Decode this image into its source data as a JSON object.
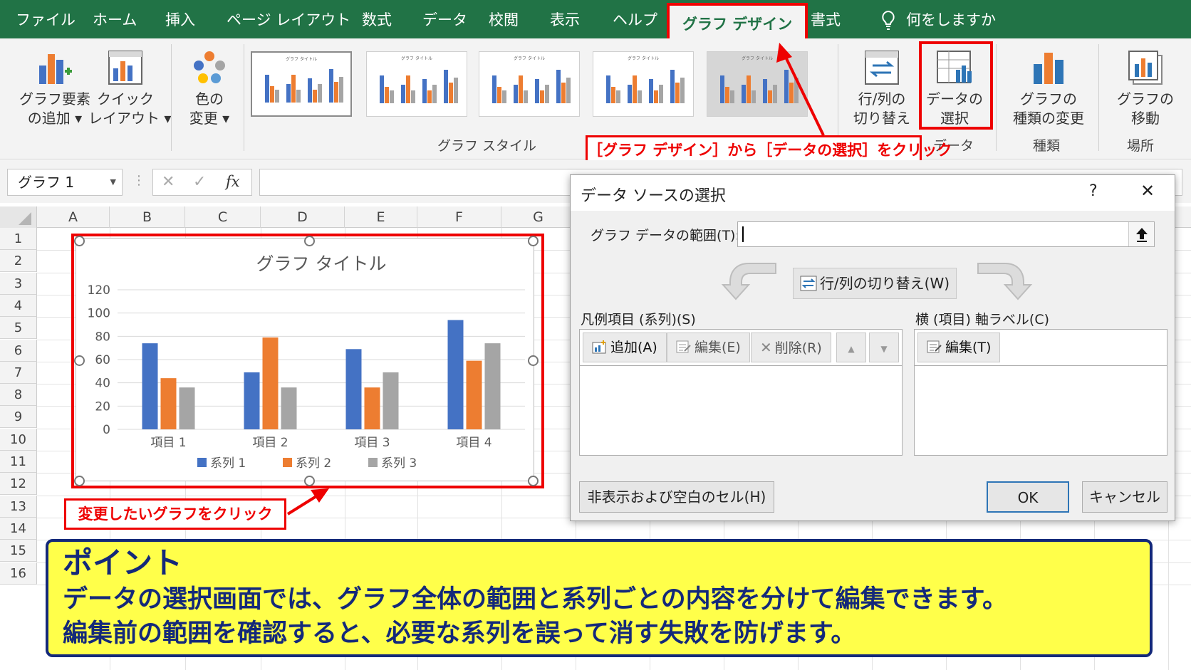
{
  "menu": {
    "tabs": [
      "ファイル",
      "ホーム",
      "挿入",
      "ページ レイアウト",
      "数式",
      "データ",
      "校閲",
      "表示",
      "ヘルプ",
      "グラフ デザイン",
      "書式"
    ],
    "search": "何をしますか"
  },
  "ribbon": {
    "add_element": [
      "グラフ要素",
      "の追加 ▾"
    ],
    "quick_layout": [
      "クイック",
      "レイアウト ▾"
    ],
    "change_color": [
      "色の",
      "変更 ▾"
    ],
    "style_group_label": "グラフ スタイル",
    "thumb_title": "グラフ タイトル",
    "switch_rowcol": [
      "行/列の",
      "切り替え"
    ],
    "select_data": [
      "データの",
      "選択"
    ],
    "data_group_label": "データ",
    "change_type": [
      "グラフの",
      "種類の変更"
    ],
    "type_group_label": "種類",
    "move_chart": [
      "グラフの",
      "移動"
    ],
    "location_group_label": "場所"
  },
  "callouts": {
    "ribbon": "［グラフ デザイン］から［データの選択］をクリック",
    "chart": "変更したいグラフをクリック"
  },
  "formula_bar": {
    "name_box": "グラフ 1",
    "cancel": "✕",
    "enter": "✓",
    "fx": "fx"
  },
  "sheet": {
    "columns": [
      "A",
      "B",
      "C",
      "D",
      "E",
      "F",
      "G"
    ],
    "rows": [
      "1",
      "2",
      "3",
      "4",
      "5",
      "6",
      "7",
      "8",
      "9",
      "10",
      "11",
      "12",
      "13",
      "14",
      "15",
      "16"
    ]
  },
  "chart_data": {
    "type": "bar",
    "title": "グラフ タイトル",
    "categories": [
      "項目 1",
      "項目 2",
      "項目 3",
      "項目 4"
    ],
    "series": [
      {
        "name": "系列 1",
        "values": [
          74,
          49,
          69,
          94
        ],
        "color": "#4472C4"
      },
      {
        "name": "系列 2",
        "values": [
          44,
          79,
          36,
          59
        ],
        "color": "#ED7D31"
      },
      {
        "name": "系列 3",
        "values": [
          36,
          36,
          49,
          74
        ],
        "color": "#A5A5A5"
      }
    ],
    "ylim": [
      0,
      120
    ],
    "yticks": [
      "0",
      "20",
      "40",
      "60",
      "80",
      "100",
      "120"
    ],
    "grid": true,
    "legend": "bottom"
  },
  "dialog": {
    "title": "データ ソースの選択",
    "help": "?",
    "close": "✕",
    "range_label": "グラフ データの範囲(T):",
    "range_value": "",
    "switch_button": "行/列の切り替え(W)",
    "legend_label": "凡例項目 (系列)(S)",
    "add": "追加(A)",
    "edit": "編集(E)",
    "delete": "削除(R)",
    "axis_label": "横 (項目) 軸ラベル(C)",
    "axis_edit": "編集(T)",
    "hidden_cells": "非表示および空白のセル(H)",
    "ok": "OK",
    "cancel": "キャンセル"
  },
  "point": {
    "heading": "ポイント",
    "line1": "データの選択画面では、グラフ全体の範囲と系列ごとの内容を分けて編集できます。",
    "line2": "編集前の範囲を確認すると、必要な系列を誤って消す失敗を防げます。"
  }
}
